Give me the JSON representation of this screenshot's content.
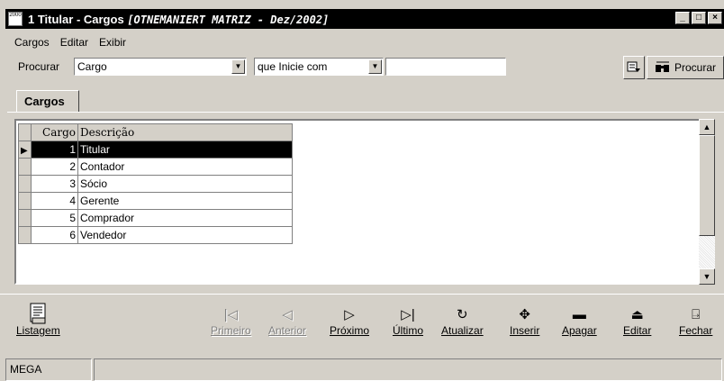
{
  "window": {
    "icon_text": "2000",
    "title": "1 Titular - Cargos",
    "subtitle": "[OTNEMANIERT MATRIZ - Dez/2002]",
    "controls": [
      "_",
      "□",
      "×"
    ]
  },
  "menu": [
    "Cargos",
    "Editar",
    "Exibir"
  ],
  "search": {
    "label": "Procurar",
    "field_value": "Cargo",
    "condition_value": "que Inicie com",
    "text_value": "",
    "search_button": "Procurar"
  },
  "tab": {
    "label": "Cargos"
  },
  "grid": {
    "columns": [
      "Cargo",
      "Descrição"
    ],
    "rows": [
      {
        "cargo": "1",
        "descricao": "Titular"
      },
      {
        "cargo": "2",
        "descricao": "Contador"
      },
      {
        "cargo": "3",
        "descricao": "Sócio"
      },
      {
        "cargo": "4",
        "descricao": "Gerente"
      },
      {
        "cargo": "5",
        "descricao": "Comprador"
      },
      {
        "cargo": "6",
        "descricao": "Vendedor"
      }
    ],
    "selected_row": 0
  },
  "buttons": {
    "listagem": "Listagem",
    "primeiro": "Primeiro",
    "anterior": "Anterior",
    "proximo": "Próximo",
    "ultimo": "Último",
    "atualizar": "Atualizar",
    "inserir": "Inserir",
    "apagar": "Apagar",
    "editar": "Editar",
    "fechar": "Fechar"
  },
  "status": {
    "panel1": "MEGA",
    "panel2": ""
  }
}
